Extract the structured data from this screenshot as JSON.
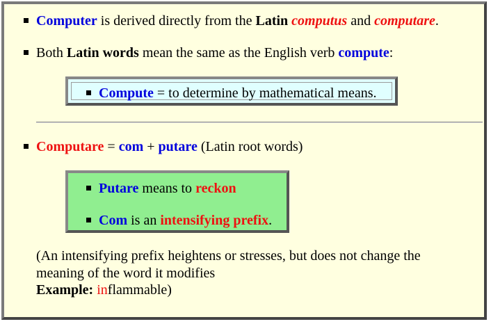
{
  "line1": {
    "t1": "Computer",
    "t2": " is derived directly from the ",
    "t3": "Latin",
    "t4": " ",
    "t5": "computus",
    "t6": " and ",
    "t7": "computare",
    "t8": "."
  },
  "line2": {
    "t1": "Both ",
    "t2": "Latin words",
    "t3": " mean the same as the English verb ",
    "t4": "compute",
    "t5": ":"
  },
  "box1": {
    "t1": "Compute",
    "t2": " = to determine by mathematical means."
  },
  "line3": {
    "t1": "Computare",
    "t2": " = ",
    "t3": "com",
    "t4": " + ",
    "t5": "putare",
    "t6": " (Latin root words)"
  },
  "box2": {
    "a1": "Putare",
    "a2": " means to ",
    "a3": "reckon",
    "b1": "Com",
    "b2": " is an ",
    "b3": "intensifying prefix",
    "b4": "."
  },
  "note": {
    "l1": "(An intensifying prefix heightens or stresses, but does not change the",
    "l2": "meaning of the word it modifies",
    "l3a": "Example:",
    "l3b": " ",
    "l3c": "in",
    "l3d": "flammable)"
  },
  "colors": {
    "page_bg": "#ffffe0",
    "box1_bg": "#e0ffff",
    "box2_bg": "#90ee90",
    "blue": "#0000dd",
    "red": "#ee1111"
  }
}
